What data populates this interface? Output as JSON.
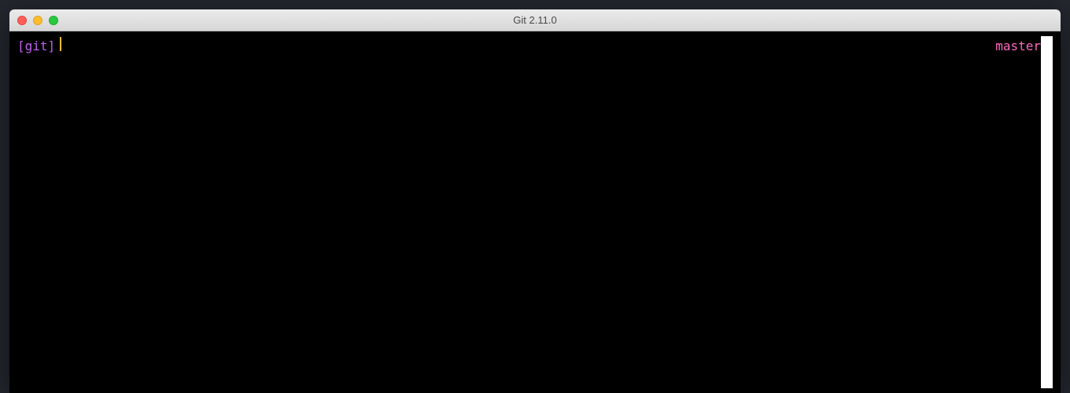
{
  "window": {
    "title": "Git 2.11.0"
  },
  "terminal": {
    "prompt": "[git]",
    "branch": "master"
  }
}
